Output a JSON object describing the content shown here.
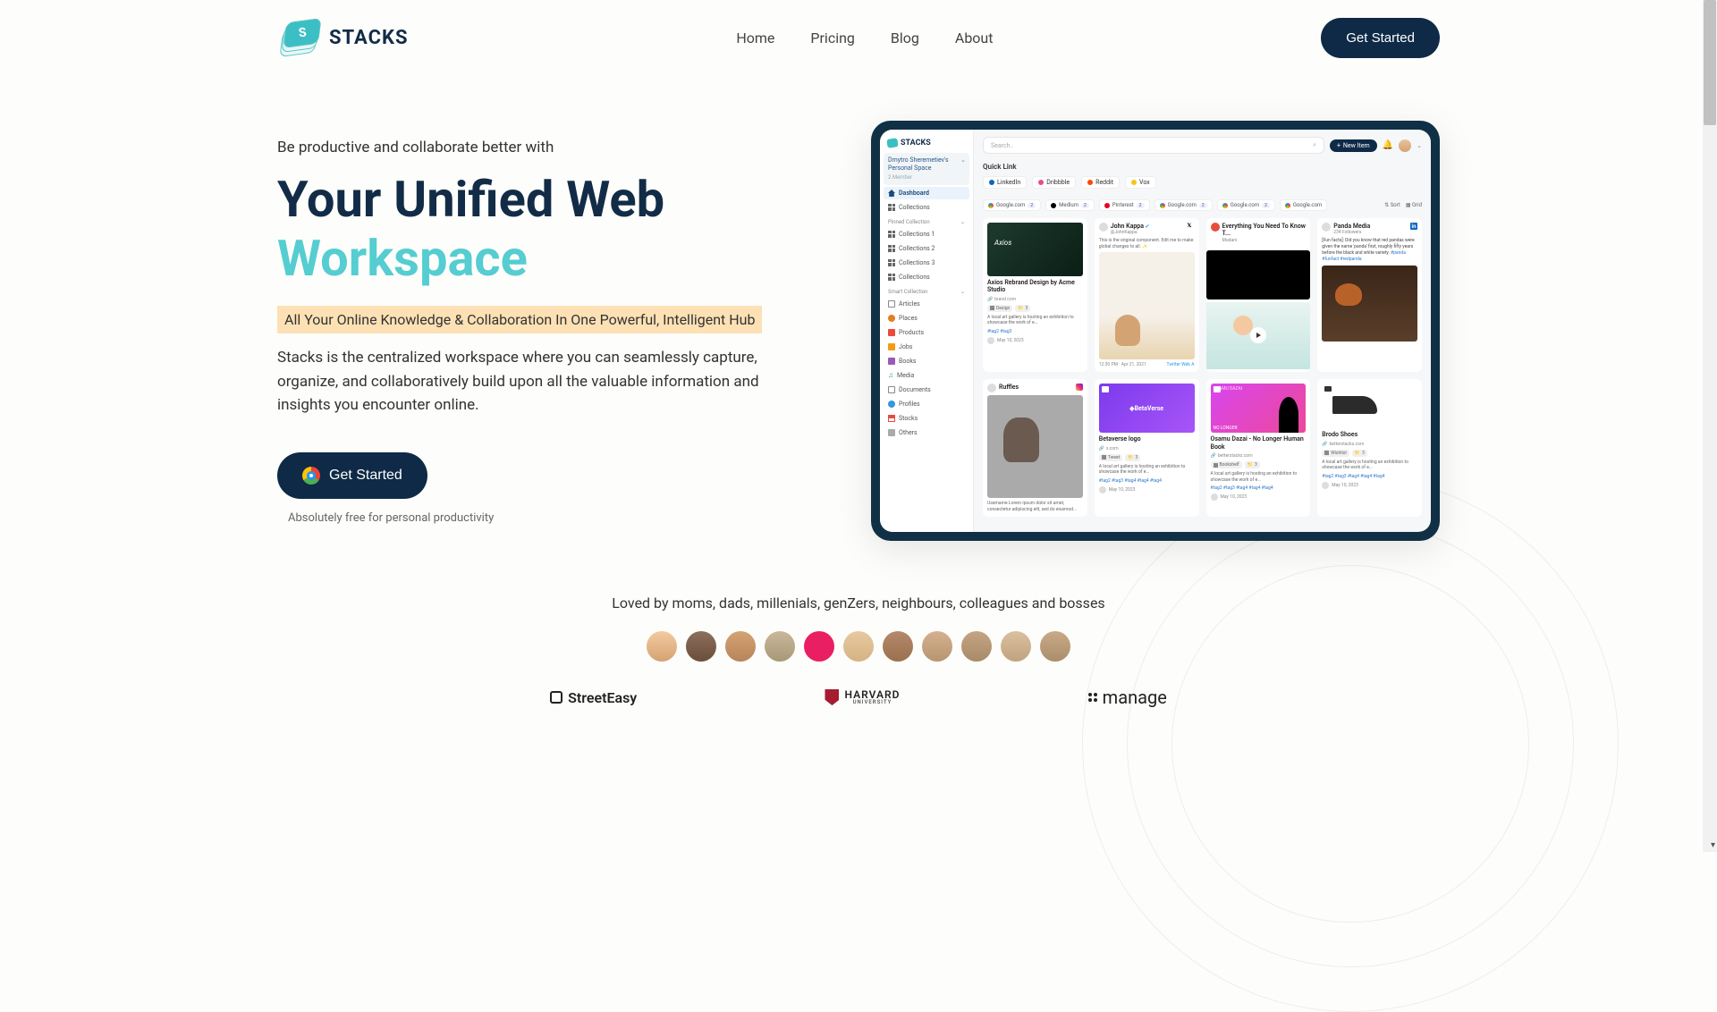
{
  "brand": {
    "name": "STACKS"
  },
  "nav": {
    "home": "Home",
    "pricing": "Pricing",
    "blog": "Blog",
    "about": "About",
    "cta": "Get Started"
  },
  "hero": {
    "eyebrow": "Be productive and collaborate better with",
    "title1": "Your Unified Web",
    "title2": "Workspace",
    "highlight": "All Your Online Knowledge & Collaboration In One Powerful, Intelligent Hub",
    "desc": "Stacks is the centralized workspace where you can seamlessly capture, organize, and collaboratively build upon all the valuable information and insights you encounter online.",
    "cta": "Get Started",
    "sub": "Absolutely free for personal productivity"
  },
  "app": {
    "logo": "STACKS",
    "space": {
      "name": "Dmytro Sheremetiev's Personal Space",
      "member": "2 Member"
    },
    "nav": {
      "dashboard": "Dashboard",
      "collections": "Collections"
    },
    "pinnedSection": "Pinned Collection",
    "pinned": {
      "c1": "Collections 1",
      "c2": "Collections 2",
      "c3": "Collections 3",
      "c4": "Collections"
    },
    "smartSection": "Smart Collection",
    "smart": {
      "articles": "Articles",
      "places": "Places",
      "products": "Products",
      "jobs": "Jobs",
      "books": "Books",
      "media": "Media",
      "documents": "Documents",
      "profiles": "Profiles",
      "stocks": "Stocks",
      "others": "Others"
    },
    "search": {
      "placeholder": "Search.."
    },
    "newItem": "New Item",
    "quickLink": "Quick Link",
    "ql": {
      "li": "LinkedIn",
      "dr": "Dribbble",
      "rd": "Reddit",
      "vx": "Vox"
    },
    "filters": {
      "g1": "Google.com",
      "b1": "2",
      "md": "Medium",
      "b2": "2",
      "pt": "Pinterest",
      "b3": "2",
      "g2": "Google.com",
      "b4": "2",
      "g3": "Google.com",
      "b5": "2",
      "g4": "Google.com"
    },
    "controls": {
      "sort": "Sort",
      "grid": "Grid"
    },
    "cards": {
      "axios": {
        "title": "Axios Rebrand Design by Acme Studio",
        "source": "brand.com",
        "tag1": "Design",
        "tag1n": "3",
        "desc": "A local art gallery is hosting an exhibition to showcase the work of e...",
        "hash": "#tag2  #tag3",
        "date": "May 10, 2023"
      },
      "kappa": {
        "name": "John Kappa",
        "handle": "@JohnKappa",
        "body": "This is the original component. Edit me to make global changes to all. ✨",
        "time": "12:30 PM · Apr 21, 2021",
        "via": "Twitter Web A"
      },
      "video": {
        "title": "Everything You Need To Know T...",
        "source": "Mudani"
      },
      "panda": {
        "name": "Panda Media",
        "sub": "234 Followers",
        "text": "[Fun facts]: Did you know that red pandas were given the name 'panda' first, roughly fifty years before the black and white variety.",
        "hash": "#panda #funfact #redpanda"
      },
      "dog": {
        "user": "Ruffles",
        "caption": "Username Lorem ipsum dolor sit amet, consectetur adipiscing elit, sed do eiusmod..."
      },
      "bv": {
        "brand": "BetaVerse",
        "title": "Betaverse logo",
        "source": "x.com",
        "tag": "Tweet",
        "tagn": "3",
        "desc": "A local art gallery is hosting an exhibition to showcase the work of e...",
        "hash": "#tag2  #tag3  #tag4  #tag4  #tag4",
        "date": "May 10, 2023"
      },
      "osamu": {
        "img_t1": "OSAMU DAZAI",
        "img_t2": "NO LONGER",
        "title": "Osamu Dazai - No Longer Human Book",
        "source": "betterstacks.com",
        "tag": "Bookshelf",
        "tagn": "3",
        "desc": "A local art gallery is hosting an exhibition to showcase the work of e...",
        "hash": "#tag2  #tag3  #tag4  #tag4  #tag4",
        "date": "May 10, 2023"
      },
      "shoe": {
        "title": "Brodo Shoes",
        "source": "betterstacks.com",
        "tag": "Wishlist",
        "tagn": "3",
        "desc": "A local art gallery is hosting an exhibition to showcase the work of e...",
        "hash": "#tag2  #tag3  #tag4  #tag4  #tag4",
        "date": "May 10, 2023"
      }
    }
  },
  "social": {
    "text": "Loved by moms, dads, millenials, genZers, neighbours, colleagues and bosses",
    "logos": {
      "streeteasy": "StreetEasy",
      "harvard1": "HARVARD",
      "harvard2": "UNIVERSITY",
      "manage": "manage"
    }
  }
}
